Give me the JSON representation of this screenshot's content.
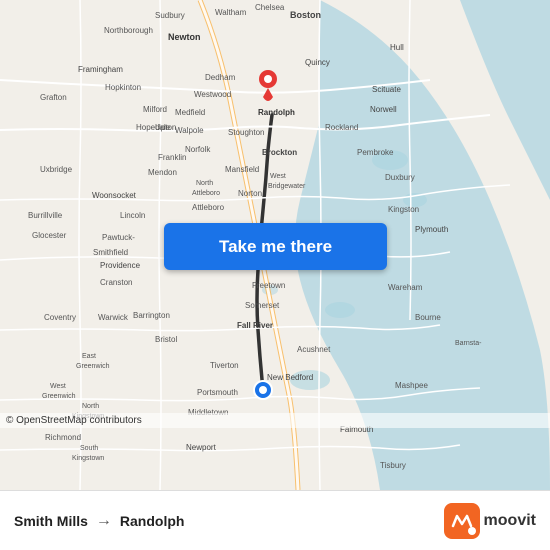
{
  "map": {
    "attribution": "© OpenStreetMap contributors",
    "background_color": "#e8e0d8"
  },
  "button": {
    "label": "Take me there"
  },
  "bottom_bar": {
    "origin": "Smith Mills",
    "destination": "Randolph",
    "arrow": "→",
    "logo_text": "moovit"
  },
  "icons": {
    "origin_pin": "blue-circle",
    "destination_pin": "red-teardrop",
    "arrow": "right-arrow"
  },
  "colors": {
    "button_bg": "#1a73e8",
    "button_text": "#ffffff",
    "origin_dot": "#1a73e8",
    "destination_pin": "#e53935",
    "moovit_orange": "#f26522",
    "map_bg": "#e8e0d8",
    "road_color": "#ffffff",
    "water_color": "#aad3df",
    "land_color": "#f5f1ec"
  }
}
